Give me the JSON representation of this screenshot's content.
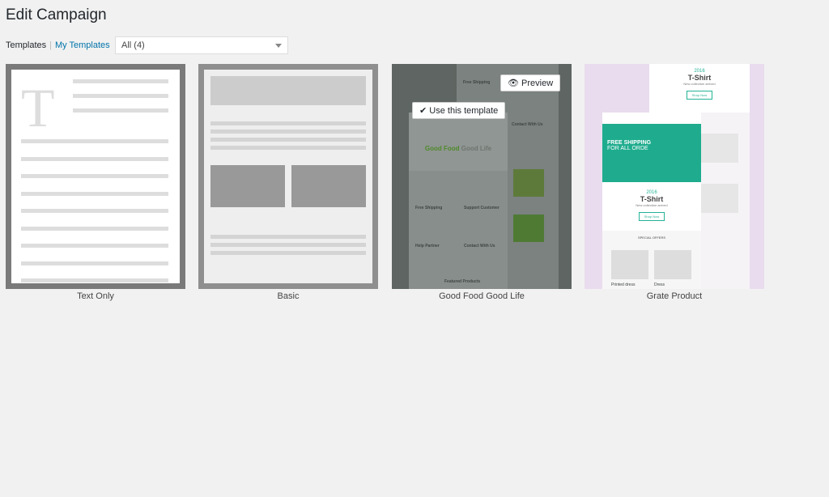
{
  "page": {
    "title": "Edit Campaign"
  },
  "tabs": {
    "current": "Templates",
    "separator": "|",
    "other": "My Templates"
  },
  "filter": {
    "selected": "All (4)"
  },
  "templates": [
    {
      "name": "Text Only"
    },
    {
      "name": "Basic"
    },
    {
      "name": "Good Food Good Life",
      "hover": true,
      "actions": {
        "use": "Use this template",
        "preview": "Preview"
      },
      "thumb": {
        "heading_green": "Good Food",
        "heading_gray": "Good Life",
        "items": [
          "Free Shipping",
          "Support Customer",
          "Help Partner",
          "Contact With Us"
        ],
        "footer": "Featured Products"
      }
    },
    {
      "name": "Grate Product",
      "thumb": {
        "year": "2016",
        "product": "T-Shirt",
        "sub": "New collection arrived",
        "cta": "Shop Now",
        "banner1": "FREE SHIPPING",
        "banner2": "FOR ALL ORDE",
        "offers": "SPECIAL OFFERS",
        "items": [
          "Printed dress",
          "Dress"
        ]
      }
    }
  ],
  "colors": {
    "link": "#0073aa",
    "teal": "#24b295",
    "green": "#4e8a2a"
  }
}
